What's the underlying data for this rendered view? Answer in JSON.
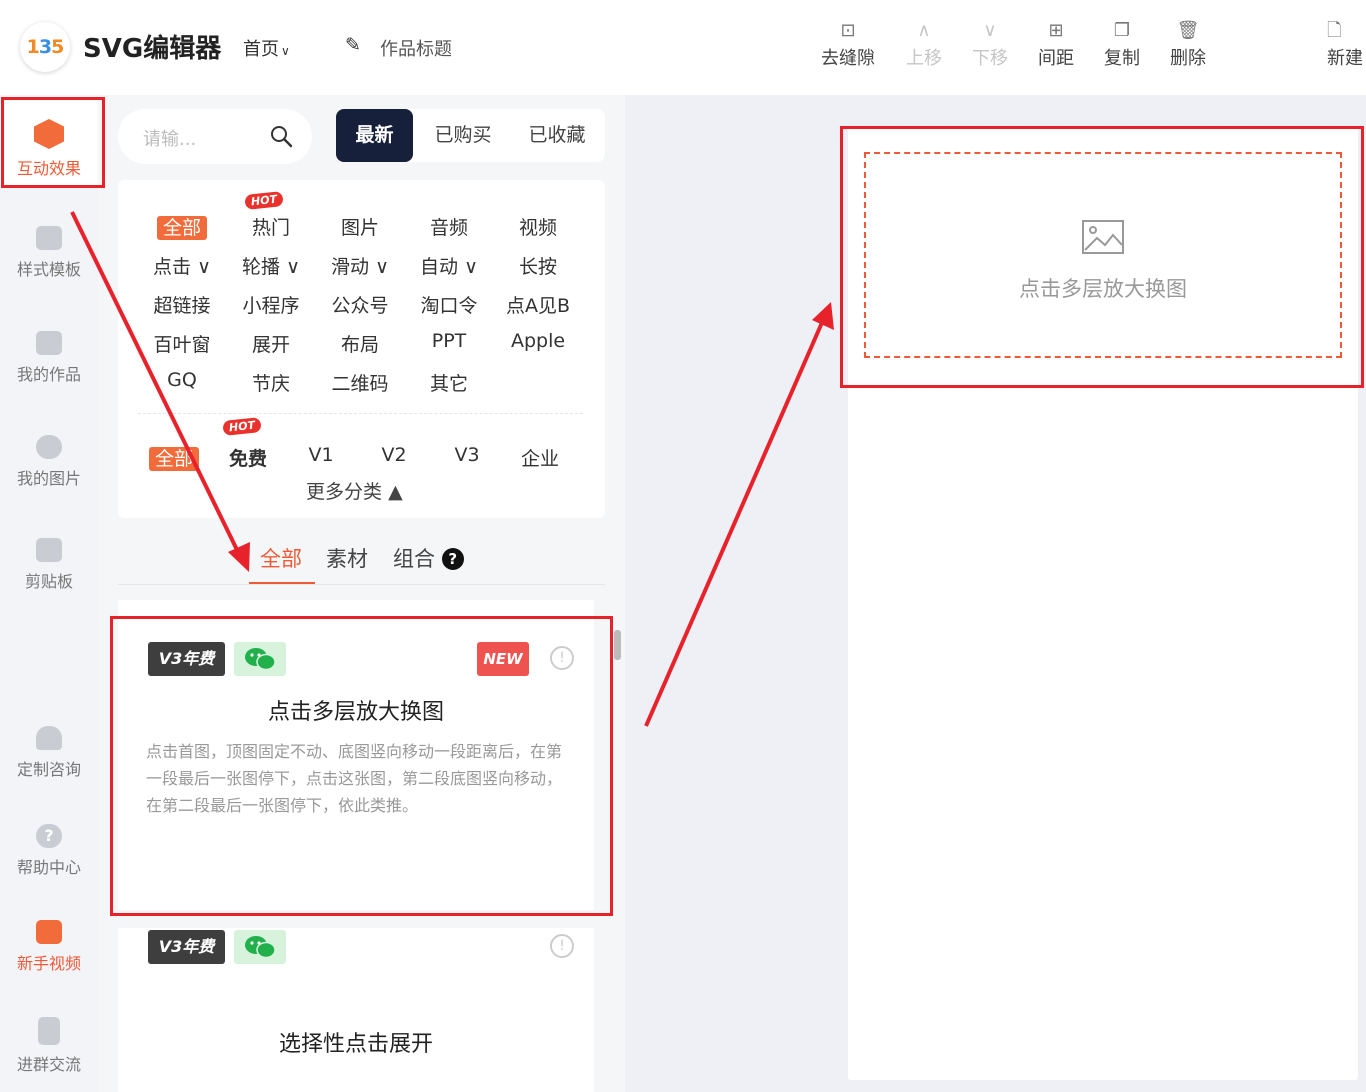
{
  "header": {
    "logo_text": "135",
    "app_title": "SVG编辑器",
    "nav_home": "首页",
    "work_title": "作品标题",
    "toolbar": [
      {
        "icon": "remove-gap-icon",
        "label": "去缝隙",
        "enabled": true
      },
      {
        "icon": "chevron-up-icon",
        "label": "上移",
        "enabled": false
      },
      {
        "icon": "chevron-down-icon",
        "label": "下移",
        "enabled": false
      },
      {
        "icon": "spacing-icon",
        "label": "间距",
        "enabled": true
      },
      {
        "icon": "copy-icon",
        "label": "复制",
        "enabled": true
      },
      {
        "icon": "trash-icon",
        "label": "删除",
        "enabled": true
      },
      {
        "icon": "new-file-icon",
        "label": "新建",
        "enabled": true
      }
    ]
  },
  "rail": [
    {
      "icon": "cube-icon",
      "label": "互动效果",
      "active": true
    },
    {
      "icon": "template-icon",
      "label": "样式模板"
    },
    {
      "icon": "folder-icon",
      "label": "我的作品"
    },
    {
      "icon": "cloud-upload-icon",
      "label": "我的图片"
    },
    {
      "icon": "clipboard-icon",
      "label": "剪贴板"
    },
    {
      "icon": "headset-icon",
      "label": "定制咨询"
    },
    {
      "icon": "help-icon",
      "label": "帮助中心"
    },
    {
      "icon": "video-icon",
      "label": "新手视频"
    },
    {
      "icon": "document-icon",
      "label": "进群交流"
    }
  ],
  "search": {
    "placeholder": "请输..."
  },
  "top_tabs": [
    "最新",
    "已购买",
    "已收藏"
  ],
  "categories": {
    "row1": [
      "全部",
      "热门",
      "图片",
      "音频",
      "视频"
    ],
    "row2": [
      "点击",
      "轮播",
      "滑动",
      "自动",
      "长按"
    ],
    "row3": [
      "超链接",
      "小程序",
      "公众号",
      "淘口令",
      "点A见B"
    ],
    "row4": [
      "百叶窗",
      "展开",
      "布局",
      "PPT",
      "Apple"
    ],
    "row5": [
      "GQ",
      "节庆",
      "二维码",
      "其它"
    ],
    "hot_badge": "HOT"
  },
  "tiers": {
    "items": [
      "全部",
      "免费",
      "V1",
      "V2",
      "V3",
      "企业"
    ],
    "more": "更多分类"
  },
  "subtabs": [
    "全部",
    "素材",
    "组合"
  ],
  "cards": [
    {
      "badge_v3": "V3年费",
      "badge_new": "NEW",
      "title": "点击多层放大换图",
      "desc": "点击首图，顶图固定不动、底图竖向移动一段距离后，在第一段最后一张图停下，点击这张图，第二段底图竖向移动，在第二段最后一张图停下，依此类推。"
    },
    {
      "badge_v3": "V3年费",
      "title": "选择性点击展开"
    }
  ],
  "canvas": {
    "placeholder_text": "点击多层放大换图"
  },
  "colors": {
    "accent": "#ee5a36",
    "dark_tab": "#16203a",
    "annotation_red": "#e8222b"
  }
}
